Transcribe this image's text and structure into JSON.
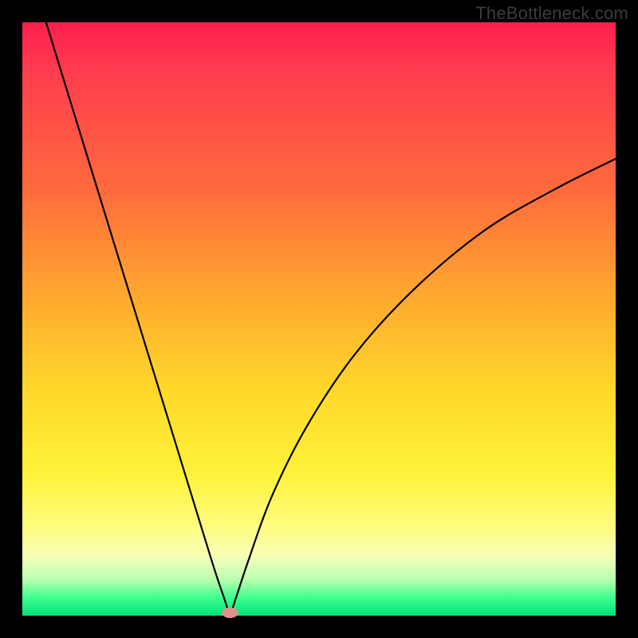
{
  "watermark": "TheBottleneck.com",
  "colors": {
    "outer_border": "#000000",
    "curve_stroke": "#000000",
    "marker_fill": "#e2908b",
    "gradient_top": "#ff1f4e",
    "gradient_bottom": "#00e07a"
  },
  "chart_data": {
    "type": "line",
    "title": "",
    "xlabel": "",
    "ylabel": "",
    "xlim": [
      0,
      100
    ],
    "ylim": [
      0,
      100
    ],
    "grid": false,
    "legend": false,
    "series": [
      {
        "name": "bottleneck-curve",
        "x": [
          4,
          8,
          12,
          16,
          20,
          24,
          28,
          32,
          34,
          35,
          36,
          38,
          42,
          48,
          56,
          66,
          78,
          90,
          100
        ],
        "y": [
          100,
          87,
          74,
          61,
          48,
          35,
          22,
          9,
          3,
          0.5,
          3,
          9,
          20,
          32,
          44,
          55,
          65,
          72,
          77
        ]
      }
    ],
    "marker": {
      "x": 35,
      "y": 0.5,
      "rx": 1.4,
      "ry": 0.9
    },
    "notes": "V-shaped bottleneck curve; y≈0 (green) at x≈35, rising toward red at extremes. Values estimated from pixels."
  }
}
